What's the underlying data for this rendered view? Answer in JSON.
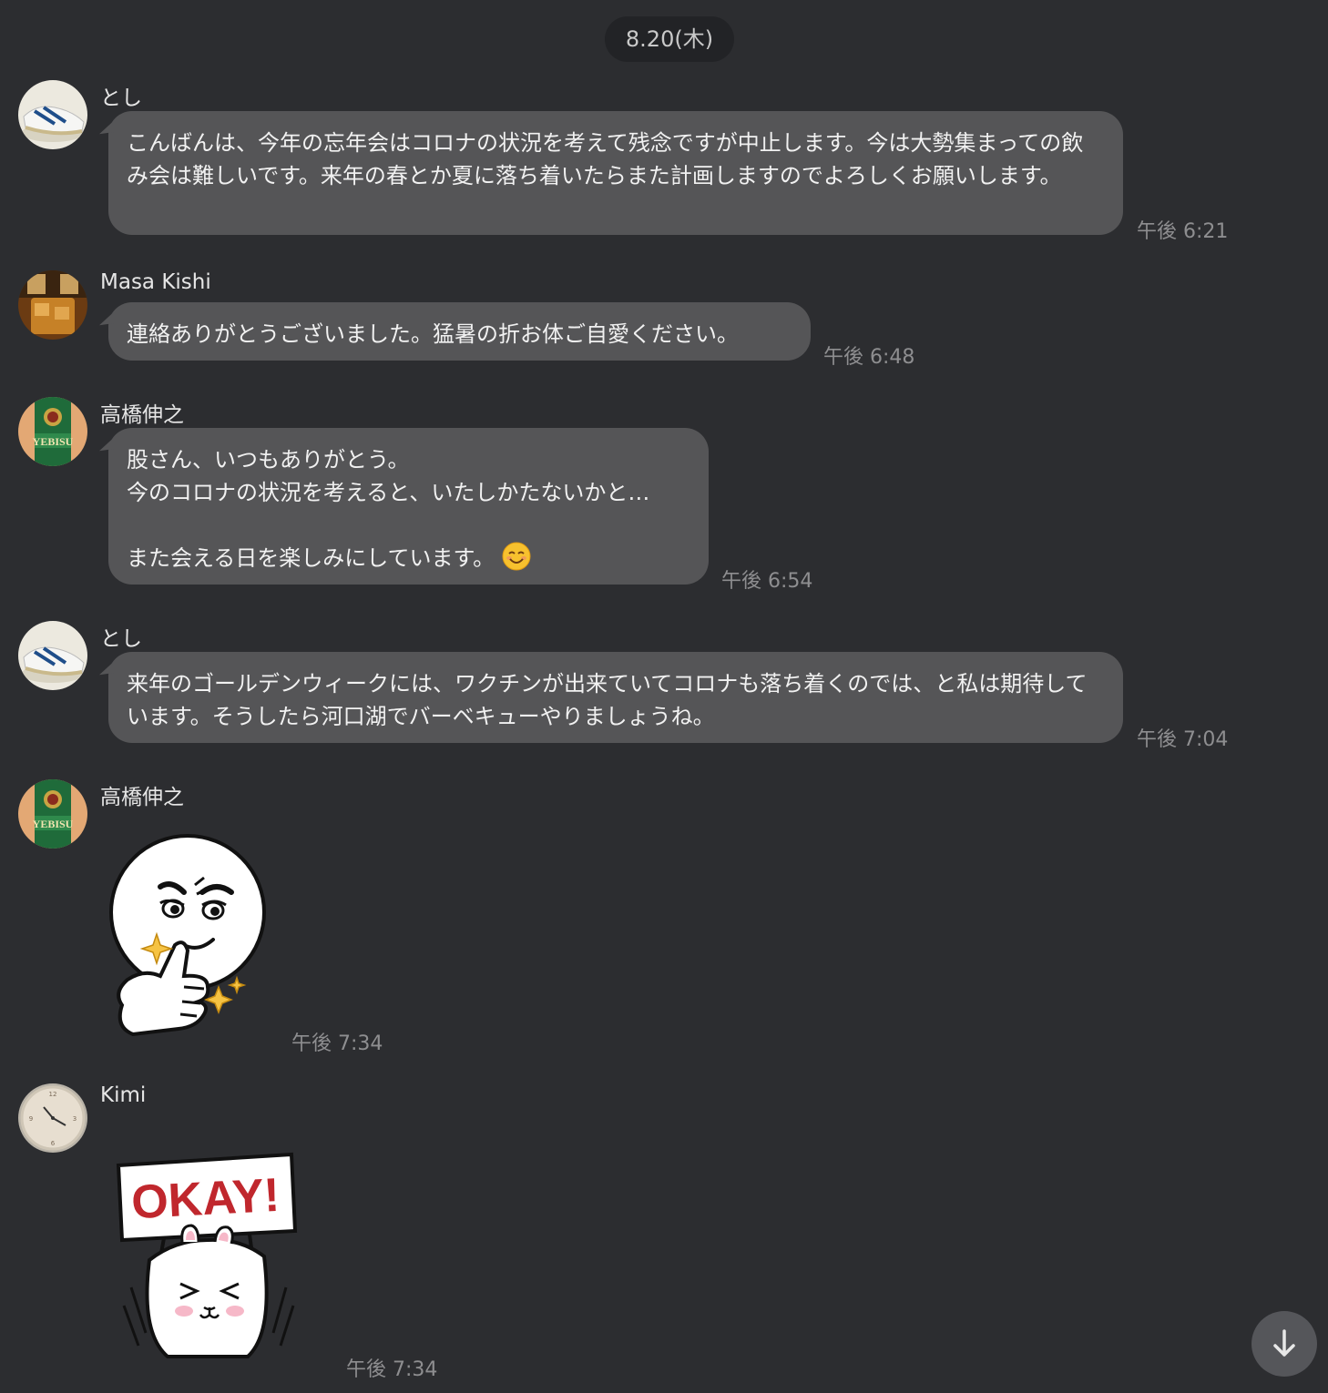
{
  "date_separator": "8.20(木)",
  "messages": [
    {
      "sender": "とし",
      "avatar": "sneaker-avatar-icon",
      "text": "こんばんは、今年の忘年会はコロナの状況を考えて残念ですが中止します。今は大勢集まっての飲み会は難しいです。来年の春とか夏に落ち着いたらまた計画しますのでよろしくお願いします。",
      "time": "午後 6:21"
    },
    {
      "sender": "Masa Kishi",
      "avatar": "whisky-glass-avatar-icon",
      "text": "連絡ありがとうございました。猛暑の折お体ご自愛ください。",
      "time": "午後 6:48"
    },
    {
      "sender": "高橋伸之",
      "avatar": "yebisu-beer-avatar-icon",
      "text": "股さん、いつもありがとう。\n今のコロナの状況を考えると、いたしかたないかと…\n\nまた会える日を楽しみにしています。",
      "emoji": "smiling-face-emoji-icon",
      "time": "午後 6:54"
    },
    {
      "sender": "とし",
      "avatar": "sneaker-avatar-icon",
      "text": "来年のゴールデンウィークには、ワクチンが出来ていてコロナも落ち着くのでは、と私は期待しています。そうしたら河口湖でバーベキューやりましょうね。",
      "time": "午後 7:04"
    },
    {
      "sender": "高橋伸之",
      "avatar": "yebisu-beer-avatar-icon",
      "sticker": "moon-thumbs-up-sticker",
      "time": "午後 7:34"
    },
    {
      "sender": "Kimi",
      "avatar": "wall-clock-avatar-icon",
      "sticker": "cony-okay-sticker",
      "sticker_text": "OKAY!",
      "time": "午後 7:34"
    }
  ],
  "scroll_button": "arrow-down-icon",
  "colors": {
    "background": "#2c2d30",
    "bubble": "#555557",
    "date_pill": "#222326",
    "timestamp": "#8e8e90",
    "sticker_red": "#c0272d"
  }
}
